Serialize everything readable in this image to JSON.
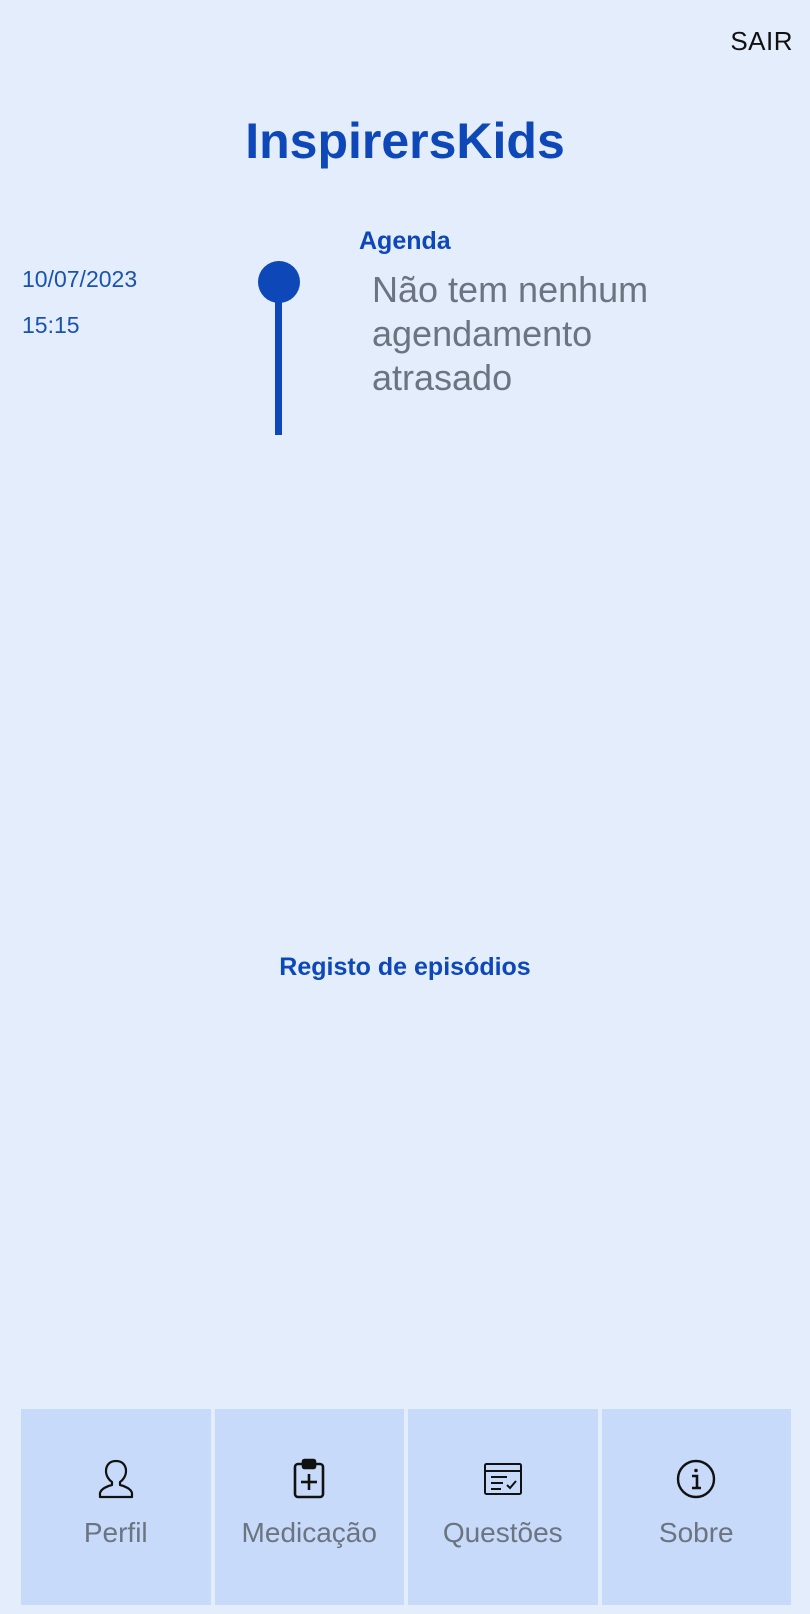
{
  "header": {
    "logout_label": "SAIR",
    "app_title": "InspirersKids"
  },
  "agenda": {
    "heading": "Agenda",
    "date": "10/07/2023",
    "time": "15:15",
    "message": "Não tem nenhum agendamento atrasado"
  },
  "episodes": {
    "link_label": "Registo de episódios"
  },
  "bottom_nav": {
    "items": [
      {
        "label": "Perfil",
        "icon": "person-icon"
      },
      {
        "label": "Medicação",
        "icon": "clipboard-plus-icon"
      },
      {
        "label": "Questões",
        "icon": "checklist-window-icon"
      },
      {
        "label": "Sobre",
        "icon": "info-icon"
      }
    ]
  },
  "colors": {
    "background": "#e3edfc",
    "accent": "#0d47b8",
    "nav_tile": "#c8daf9",
    "muted_text": "#6b7480"
  }
}
